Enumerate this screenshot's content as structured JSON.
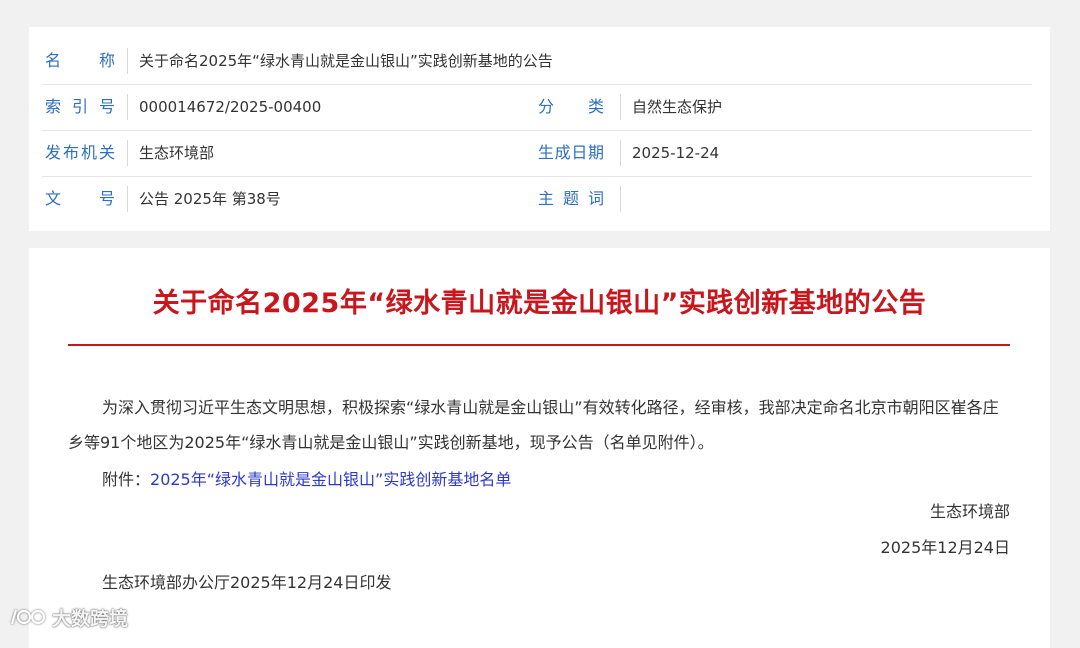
{
  "meta": {
    "rows": [
      {
        "left_label": [
          "名",
          "称"
        ],
        "left_value": "关于命名2025年“绿水青山就是金山银山”实践创新基地的公告"
      },
      {
        "left_label": [
          "索",
          "引",
          "号"
        ],
        "left_value": "000014672/2025-00400",
        "right_label": [
          "分",
          "类"
        ],
        "right_value": "自然生态保护"
      },
      {
        "left_label": [
          "发",
          "布",
          "机",
          "关"
        ],
        "left_value": "生态环境部",
        "right_label": [
          "生",
          "成",
          "日",
          "期"
        ],
        "right_value": "2025-12-24"
      },
      {
        "left_label": [
          "文",
          "号"
        ],
        "left_value": "公告 2025年 第38号",
        "right_label": [
          "主",
          "题",
          "词"
        ],
        "right_value": ""
      }
    ]
  },
  "document": {
    "title": "关于命名2025年“绿水青山就是金山银山”实践创新基地的公告",
    "paragraph": "为深入贯彻习近平生态文明思想，积极探索“绿水青山就是金山银山”有效转化路径，经审核，我部决定命名北京市朝阳区崔各庄乡等91个地区为2025年“绿水青山就是金山银山”实践创新基地，现予公告（名单见附件）。",
    "attachment_prefix": "附件：",
    "attachment_link": "2025年“绿水青山就是金山银山”实践创新基地名单",
    "signature_org": "生态环境部",
    "signature_date": "2025年12月24日",
    "footnote": "生态环境部办公厅2025年12月24日印发"
  },
  "watermark": {
    "text": "大数跨境"
  },
  "colors": {
    "label_blue": "#2e6fbe",
    "title_red": "#c8161d",
    "link_blue": "#2e39c8"
  }
}
